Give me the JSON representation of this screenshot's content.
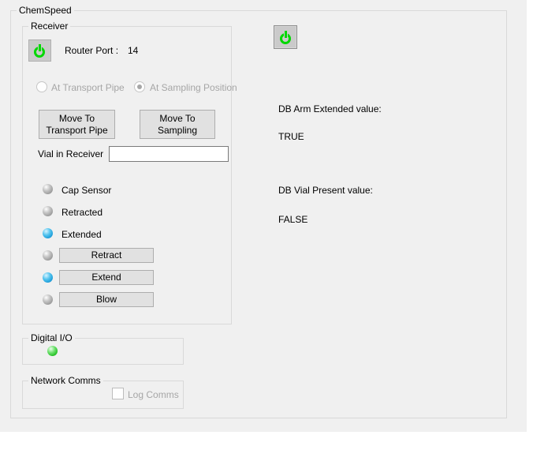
{
  "chemspeed": {
    "title": "ChemSpeed"
  },
  "receiver": {
    "title": "Receiver",
    "router_port_label": "Router Port :",
    "router_port_value": "14",
    "radios": [
      {
        "label": "At Transport Pipe",
        "selected": false,
        "enabled": false
      },
      {
        "label": "At Sampling Position",
        "selected": true,
        "enabled": false
      }
    ],
    "move_transport_button": {
      "line1": "Move To",
      "line2": "Transport Pipe"
    },
    "move_sampling_button": {
      "line1": "Move To",
      "line2": "Sampling"
    },
    "vial_label": "Vial in Receiver",
    "vial_value": "",
    "status_leds": [
      {
        "label": "Cap Sensor",
        "state": "gray"
      },
      {
        "label": "Retracted",
        "state": "gray"
      },
      {
        "label": "Extended",
        "state": "blue"
      }
    ],
    "action_rows": [
      {
        "label": "Retract",
        "led": "gray"
      },
      {
        "label": "Extend",
        "led": "blue"
      },
      {
        "label": "Blow",
        "led": "gray"
      }
    ]
  },
  "digital_io": {
    "title": "Digital I/O",
    "led_state": "green"
  },
  "network_comms": {
    "title": "Network Comms",
    "checkbox_label": "Log Comms",
    "checked": false
  },
  "right_panel": {
    "db_arm_label": "DB Arm Extended value:",
    "db_arm_value": "TRUE",
    "db_vial_label": "DB Vial Present value:",
    "db_vial_value": "FALSE"
  },
  "colors": {
    "form_background": "#f0f0f0",
    "power_green": "#00d800",
    "led_blue": "#23a2dc",
    "led_green": "#2cc52c",
    "led_gray": "#a0a0a0",
    "disabled_text": "#a6a6a6"
  }
}
